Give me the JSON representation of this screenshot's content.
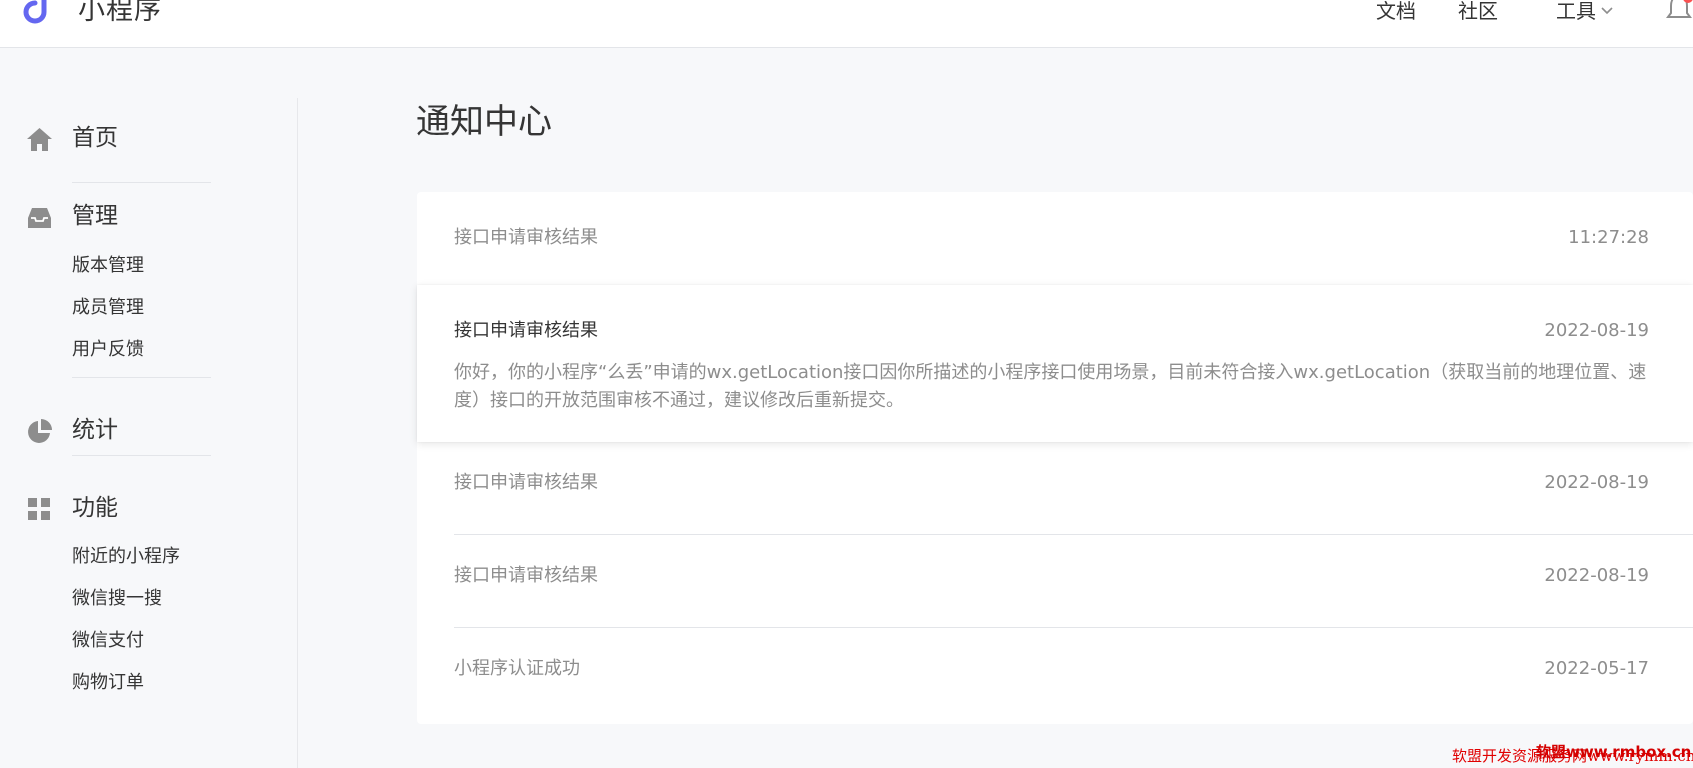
{
  "header": {
    "app_title": "小程序",
    "nav": {
      "docs": "文档",
      "community": "社区",
      "tools": "工具"
    },
    "brand_color": "#6467f0"
  },
  "sidebar": {
    "home": {
      "label": "首页",
      "icon": "home-icon"
    },
    "manage": {
      "label": "管理",
      "icon": "inbox-icon",
      "items": [
        "版本管理",
        "成员管理",
        "用户反馈"
      ]
    },
    "stats": {
      "label": "统计",
      "icon": "pie-chart-icon"
    },
    "features": {
      "label": "功能",
      "icon": "grid-icon",
      "items": [
        "附近的小程序",
        "微信搜一搜",
        "微信支付",
        "购物订单"
      ]
    }
  },
  "main": {
    "title": "通知中心",
    "notifications": [
      {
        "title": "接口申请审核结果",
        "date": "11:27:28"
      },
      {
        "title": "接口申请审核结果",
        "date": "2022-08-19",
        "body": "你好，你的小程序“么丢”申请的wx.getLocation接口因你所描述的小程序接口使用场景，目前未符合接入wx.getLocation（获取当前的地理位置、速度）接口的开放范围审核不通过，建议修改后重新提交。"
      },
      {
        "title": "接口申请审核结果",
        "date": "2022-08-19"
      },
      {
        "title": "接口申请审核结果",
        "date": "2022-08-19"
      },
      {
        "title": "小程序认证成功",
        "date": "2022-05-17"
      }
    ]
  },
  "watermark": {
    "text": "软盟开发资源服务网www.rymm.cn",
    "overlay": "软盟www.rmbox.cn"
  }
}
